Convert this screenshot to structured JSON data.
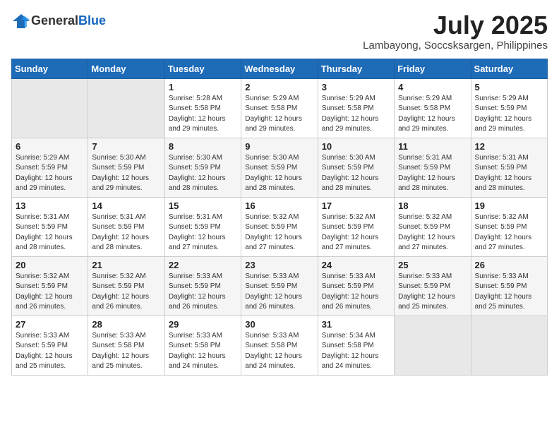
{
  "header": {
    "logo_general": "General",
    "logo_blue": "Blue",
    "month_title": "July 2025",
    "location": "Lambayong, Soccsksargen, Philippines"
  },
  "weekdays": [
    "Sunday",
    "Monday",
    "Tuesday",
    "Wednesday",
    "Thursday",
    "Friday",
    "Saturday"
  ],
  "weeks": [
    [
      {
        "day": "",
        "detail": ""
      },
      {
        "day": "",
        "detail": ""
      },
      {
        "day": "1",
        "detail": "Sunrise: 5:28 AM\nSunset: 5:58 PM\nDaylight: 12 hours and 29 minutes."
      },
      {
        "day": "2",
        "detail": "Sunrise: 5:29 AM\nSunset: 5:58 PM\nDaylight: 12 hours and 29 minutes."
      },
      {
        "day": "3",
        "detail": "Sunrise: 5:29 AM\nSunset: 5:58 PM\nDaylight: 12 hours and 29 minutes."
      },
      {
        "day": "4",
        "detail": "Sunrise: 5:29 AM\nSunset: 5:58 PM\nDaylight: 12 hours and 29 minutes."
      },
      {
        "day": "5",
        "detail": "Sunrise: 5:29 AM\nSunset: 5:59 PM\nDaylight: 12 hours and 29 minutes."
      }
    ],
    [
      {
        "day": "6",
        "detail": "Sunrise: 5:29 AM\nSunset: 5:59 PM\nDaylight: 12 hours and 29 minutes."
      },
      {
        "day": "7",
        "detail": "Sunrise: 5:30 AM\nSunset: 5:59 PM\nDaylight: 12 hours and 29 minutes."
      },
      {
        "day": "8",
        "detail": "Sunrise: 5:30 AM\nSunset: 5:59 PM\nDaylight: 12 hours and 28 minutes."
      },
      {
        "day": "9",
        "detail": "Sunrise: 5:30 AM\nSunset: 5:59 PM\nDaylight: 12 hours and 28 minutes."
      },
      {
        "day": "10",
        "detail": "Sunrise: 5:30 AM\nSunset: 5:59 PM\nDaylight: 12 hours and 28 minutes."
      },
      {
        "day": "11",
        "detail": "Sunrise: 5:31 AM\nSunset: 5:59 PM\nDaylight: 12 hours and 28 minutes."
      },
      {
        "day": "12",
        "detail": "Sunrise: 5:31 AM\nSunset: 5:59 PM\nDaylight: 12 hours and 28 minutes."
      }
    ],
    [
      {
        "day": "13",
        "detail": "Sunrise: 5:31 AM\nSunset: 5:59 PM\nDaylight: 12 hours and 28 minutes."
      },
      {
        "day": "14",
        "detail": "Sunrise: 5:31 AM\nSunset: 5:59 PM\nDaylight: 12 hours and 28 minutes."
      },
      {
        "day": "15",
        "detail": "Sunrise: 5:31 AM\nSunset: 5:59 PM\nDaylight: 12 hours and 27 minutes."
      },
      {
        "day": "16",
        "detail": "Sunrise: 5:32 AM\nSunset: 5:59 PM\nDaylight: 12 hours and 27 minutes."
      },
      {
        "day": "17",
        "detail": "Sunrise: 5:32 AM\nSunset: 5:59 PM\nDaylight: 12 hours and 27 minutes."
      },
      {
        "day": "18",
        "detail": "Sunrise: 5:32 AM\nSunset: 5:59 PM\nDaylight: 12 hours and 27 minutes."
      },
      {
        "day": "19",
        "detail": "Sunrise: 5:32 AM\nSunset: 5:59 PM\nDaylight: 12 hours and 27 minutes."
      }
    ],
    [
      {
        "day": "20",
        "detail": "Sunrise: 5:32 AM\nSunset: 5:59 PM\nDaylight: 12 hours and 26 minutes."
      },
      {
        "day": "21",
        "detail": "Sunrise: 5:32 AM\nSunset: 5:59 PM\nDaylight: 12 hours and 26 minutes."
      },
      {
        "day": "22",
        "detail": "Sunrise: 5:33 AM\nSunset: 5:59 PM\nDaylight: 12 hours and 26 minutes."
      },
      {
        "day": "23",
        "detail": "Sunrise: 5:33 AM\nSunset: 5:59 PM\nDaylight: 12 hours and 26 minutes."
      },
      {
        "day": "24",
        "detail": "Sunrise: 5:33 AM\nSunset: 5:59 PM\nDaylight: 12 hours and 26 minutes."
      },
      {
        "day": "25",
        "detail": "Sunrise: 5:33 AM\nSunset: 5:59 PM\nDaylight: 12 hours and 25 minutes."
      },
      {
        "day": "26",
        "detail": "Sunrise: 5:33 AM\nSunset: 5:59 PM\nDaylight: 12 hours and 25 minutes."
      }
    ],
    [
      {
        "day": "27",
        "detail": "Sunrise: 5:33 AM\nSunset: 5:59 PM\nDaylight: 12 hours and 25 minutes."
      },
      {
        "day": "28",
        "detail": "Sunrise: 5:33 AM\nSunset: 5:58 PM\nDaylight: 12 hours and 25 minutes."
      },
      {
        "day": "29",
        "detail": "Sunrise: 5:33 AM\nSunset: 5:58 PM\nDaylight: 12 hours and 24 minutes."
      },
      {
        "day": "30",
        "detail": "Sunrise: 5:33 AM\nSunset: 5:58 PM\nDaylight: 12 hours and 24 minutes."
      },
      {
        "day": "31",
        "detail": "Sunrise: 5:34 AM\nSunset: 5:58 PM\nDaylight: 12 hours and 24 minutes."
      },
      {
        "day": "",
        "detail": ""
      },
      {
        "day": "",
        "detail": ""
      }
    ]
  ]
}
